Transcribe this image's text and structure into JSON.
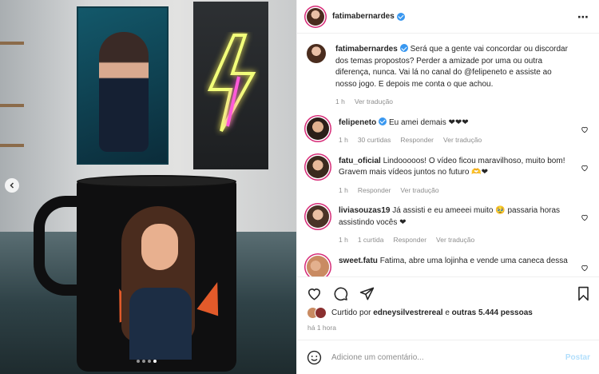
{
  "post": {
    "author": "fatimabernardes",
    "caption": "Será que a gente vai concordar ou discordar dos temas propostos? Perder a amizade por uma ou outra diferença, nunca. Vai lá no canal do @felipeneto e assiste ao nosso jogo. E depois me conta o que achou.",
    "caption_time": "1 h",
    "see_translation": "Ver tradução",
    "more_icon": "more-options-icon"
  },
  "comments": [
    {
      "user": "felipeneto",
      "verified": true,
      "text": "Eu amei demais ❤❤❤",
      "time": "1 h",
      "likes": "30 curtidas",
      "reply": "Responder",
      "translate": "Ver tradução"
    },
    {
      "user": "fatu_oficial",
      "verified": false,
      "text": "Lindooooos! O vídeo ficou maravilhoso, muito bom! Gravem mais vídeos juntos no futuro 🫶❤",
      "time": "1 h",
      "likes": "",
      "reply": "Responder",
      "translate": "Ver tradução"
    },
    {
      "user": "liviasouzas19",
      "verified": false,
      "text": "Já assisti e eu ameeei muito 🥹 passaria horas assistindo vocês ❤",
      "time": "1 h",
      "likes": "1 curtida",
      "reply": "Responder",
      "translate": "Ver tradução"
    },
    {
      "user": "sweet.fatu",
      "verified": false,
      "text": "Fatima, abre uma lojinha e vende uma caneca dessa",
      "time": "",
      "likes": "",
      "reply": "",
      "translate": ""
    }
  ],
  "likes": {
    "prefix": "Curtido por",
    "user": "edneysilvestrereal",
    "joiner": "e",
    "others": "outras 5.444 pessoas"
  },
  "post_time": "há 1 hora",
  "add_comment": {
    "placeholder": "Adicione um comentário...",
    "post_label": "Postar"
  },
  "carousel": {
    "current": 4,
    "total": 4
  },
  "colors": {
    "verified": "#3897f0",
    "link": "#00376b",
    "muted": "#8e8e8e",
    "post_disabled": "#b2dffc"
  }
}
